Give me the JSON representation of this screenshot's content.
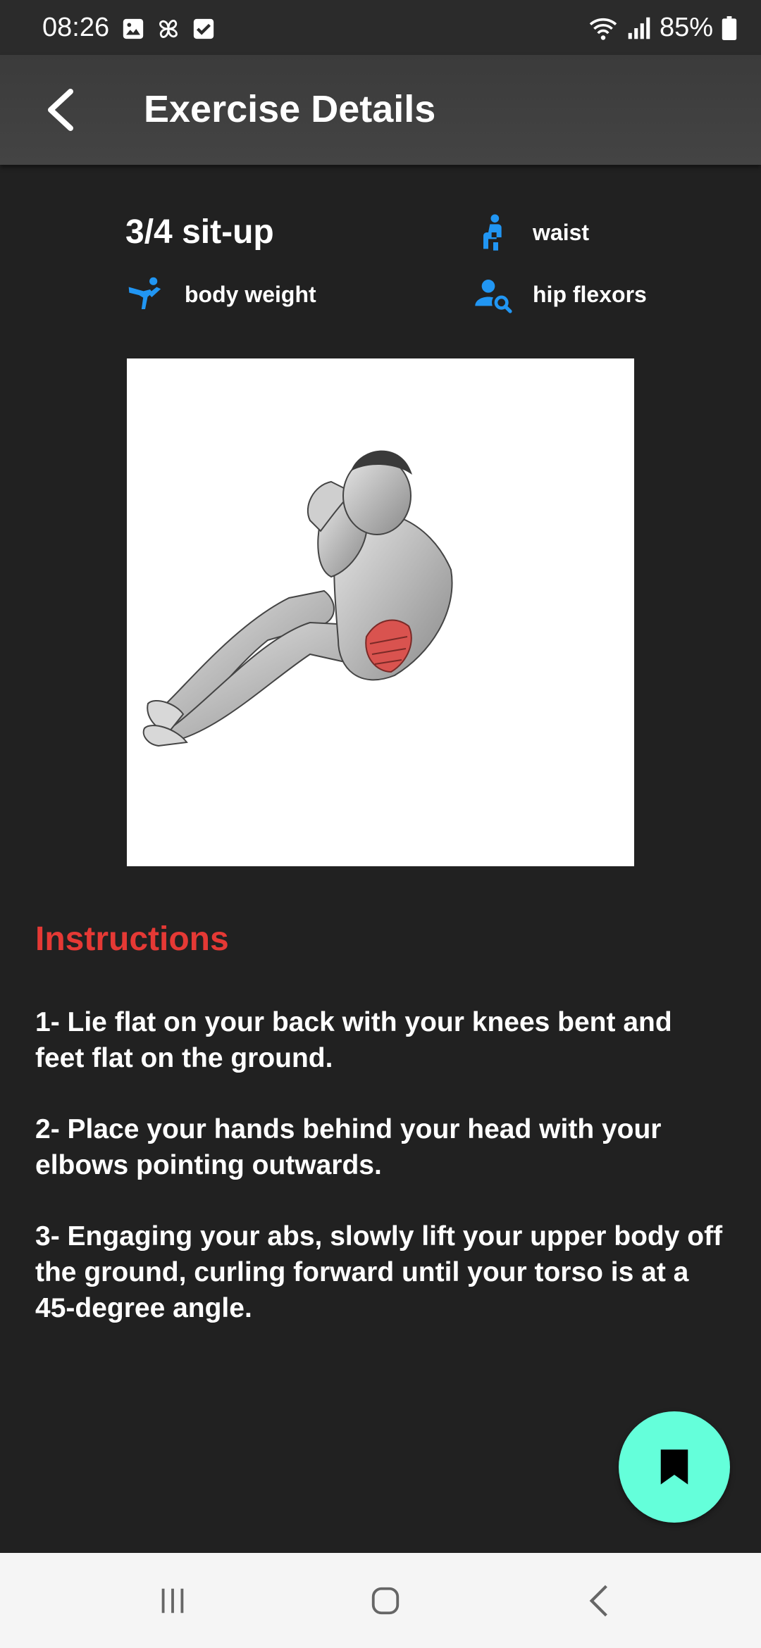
{
  "status_bar": {
    "time": "08:26",
    "battery": "85%"
  },
  "app_bar": {
    "title": "Exercise Details"
  },
  "exercise": {
    "name": "3/4 sit-up",
    "equipment": "body weight",
    "body_part": "waist",
    "target": "hip flexors"
  },
  "instructions": {
    "title": "Instructions",
    "steps": [
      "1- Lie flat on your back with your knees bent and feet flat on the ground.",
      "2- Place your hands behind your head with your elbows pointing outwards.",
      "3- Engaging your abs, slowly lift your upper body off the ground, curling forward until your torso is at a 45-degree angle."
    ]
  },
  "colors": {
    "background": "#212121",
    "app_bar": "#424242",
    "accent_icon": "#2196f3",
    "instructions_title": "#e53935",
    "fab": "#64ffda"
  },
  "icons": {
    "back": "arrow-back-icon",
    "equipment": "martial-arts-icon",
    "body_part": "person-body-icon",
    "target": "person-search-icon",
    "fab": "bookmark-icon"
  }
}
